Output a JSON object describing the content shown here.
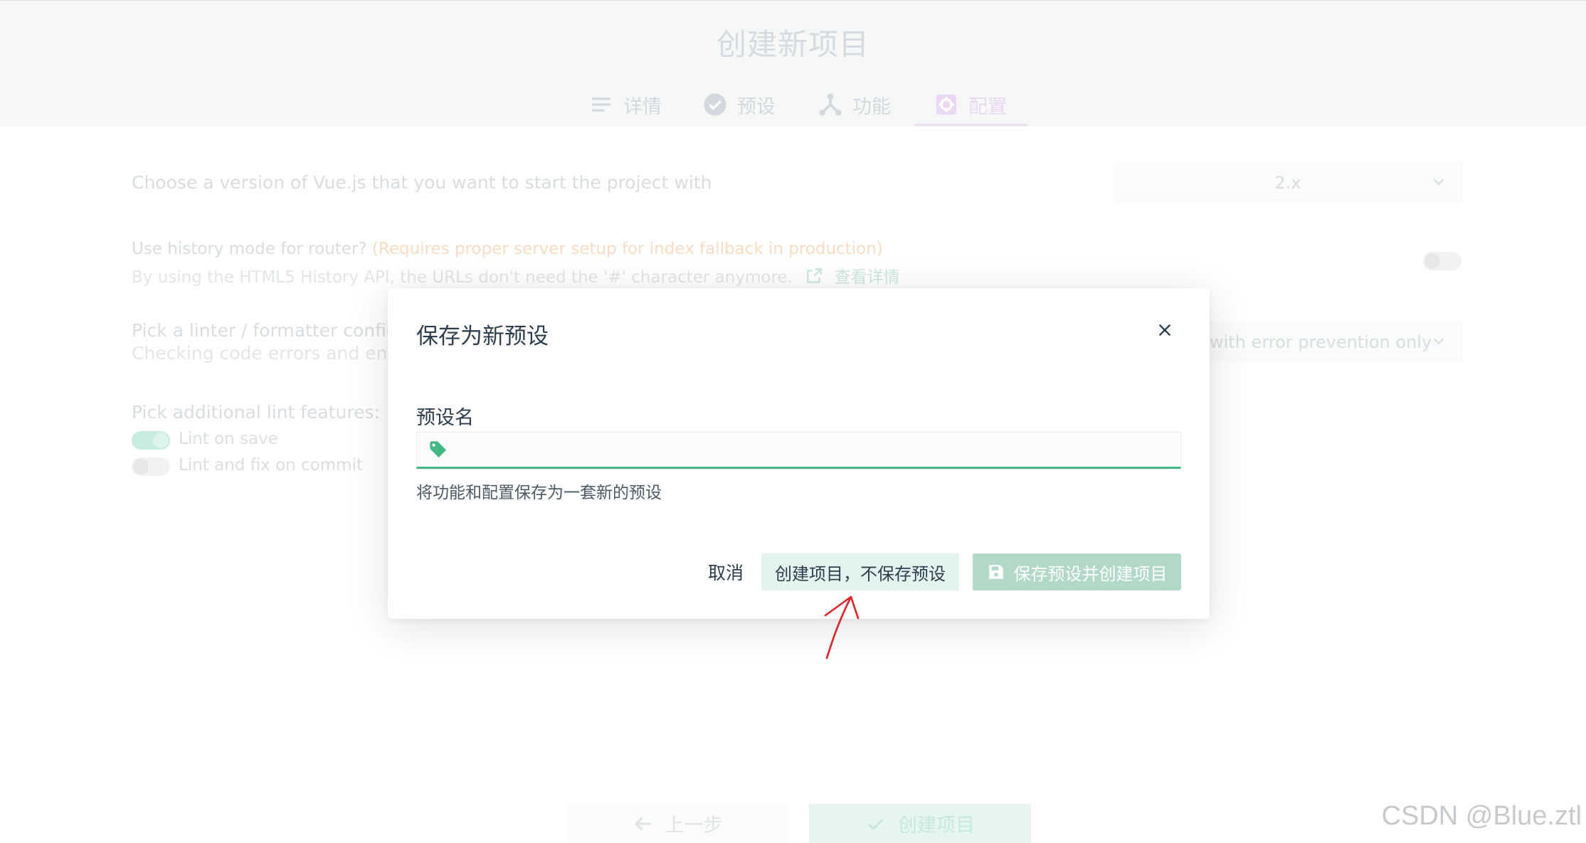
{
  "page": {
    "title": "创建新项目",
    "steps": [
      {
        "label": "详情",
        "icon": "list-icon"
      },
      {
        "label": "预设",
        "icon": "check-circle-icon"
      },
      {
        "label": "功能",
        "icon": "branch-icon"
      },
      {
        "label": "配置",
        "icon": "settings-icon",
        "active": true
      }
    ],
    "vue_version": {
      "label": "Choose a version of Vue.js that you want to start the project with",
      "value": "2.x"
    },
    "history_mode": {
      "label": "Use history mode for router?",
      "warning": "(Requires proper server setup for index fallback in production)",
      "description": "By using the HTML5 History API, the URLs don't need the '#' character anymore.",
      "link_text": "查看详情"
    },
    "linter": {
      "label": "Pick a linter / formatter config:",
      "description": "Checking code errors and enfo",
      "value": "with error prevention only"
    },
    "lint_features": {
      "label": "Pick additional lint features:",
      "options": [
        {
          "label": "Lint on save",
          "checked": true
        },
        {
          "label": "Lint and fix on commit",
          "checked": false
        }
      ]
    },
    "bottom": {
      "prev_label": "上一步",
      "create_label": "创建项目"
    }
  },
  "modal": {
    "title": "保存为新预设",
    "field_label": "预设名",
    "field_value": "",
    "field_hint": "将功能和配置保存为一套新的预设",
    "cancel_label": "取消",
    "create_no_save_label": "创建项目，不保存预设",
    "save_create_label": "保存预设并创建项目"
  },
  "watermark": "CSDN @Blue.ztl",
  "colors": {
    "accent": "#42b983",
    "annotation": "#e0232b"
  }
}
